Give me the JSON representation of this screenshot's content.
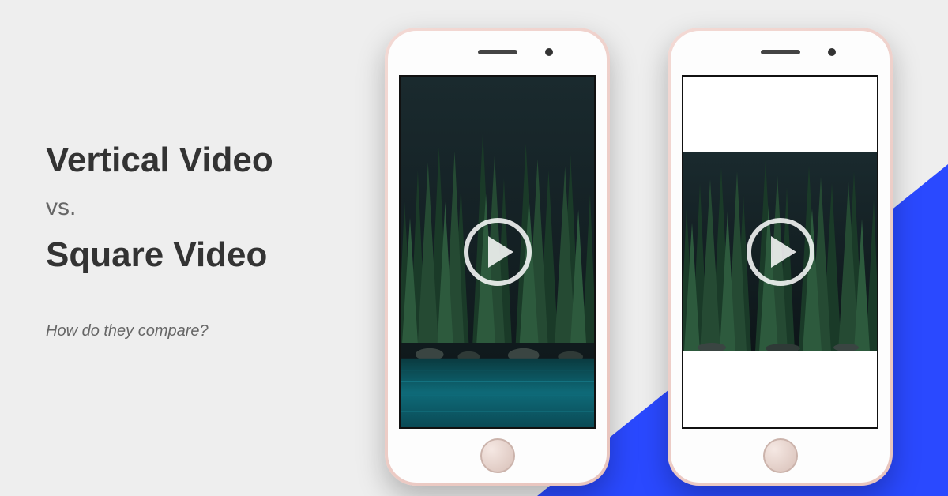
{
  "heading": {
    "line1": "Vertical Video",
    "vs": "vs.",
    "line2": "Square Video"
  },
  "subtitle": "How do they compare?",
  "phones": {
    "left": {
      "format": "vertical"
    },
    "right": {
      "format": "square"
    }
  },
  "icons": {
    "play": "play-icon"
  }
}
